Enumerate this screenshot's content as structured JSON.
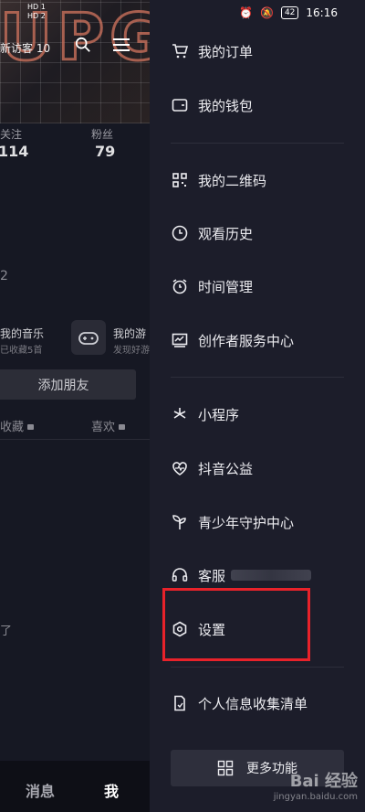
{
  "status_bar": {
    "left_badges": [
      "HD 1",
      "HD 2"
    ],
    "battery": "42",
    "time": "16:16"
  },
  "profile": {
    "visitors": "新访客 10",
    "stats": [
      {
        "label": "关注",
        "value": "114"
      },
      {
        "label": "粉丝",
        "value": "79"
      }
    ],
    "partial_heading": "2",
    "music_title": "我的音乐",
    "music_sub": "已收藏5首",
    "game_title": "我的游",
    "game_sub": "发现好游",
    "add_friend": "添加朋友",
    "tabs": [
      {
        "label": "收藏"
      },
      {
        "label": "喜欢"
      }
    ],
    "empty_tail": "了"
  },
  "bottom_nav": {
    "messages": "消息",
    "me": "我"
  },
  "drawer": {
    "items": [
      {
        "label": "我的订单",
        "icon": "cart-icon"
      },
      {
        "label": "我的钱包",
        "icon": "wallet-icon"
      },
      {
        "label": "我的二维码",
        "icon": "qrcode-icon"
      },
      {
        "label": "观看历史",
        "icon": "clock-icon"
      },
      {
        "label": "时间管理",
        "icon": "alarm-icon"
      },
      {
        "label": "创作者服务中心",
        "icon": "chart-icon"
      },
      {
        "label": "小程序",
        "icon": "asterisk-icon"
      },
      {
        "label": "抖音公益",
        "icon": "heart-pulse-icon"
      },
      {
        "label": "青少年守护中心",
        "icon": "sprout-icon"
      },
      {
        "label": "客服",
        "icon": "headset-icon"
      },
      {
        "label": "设置",
        "icon": "hexagon-settings-icon"
      },
      {
        "label": "个人信息收集清单",
        "icon": "document-icon"
      }
    ],
    "more_label": "更多功能"
  },
  "watermark": {
    "brand": "Bai 经验",
    "url": "jingyan.baidu.com"
  },
  "colors": {
    "highlight": "#e8222a",
    "drawer_bg": "#1c1d2a",
    "page_bg": "#161823"
  }
}
